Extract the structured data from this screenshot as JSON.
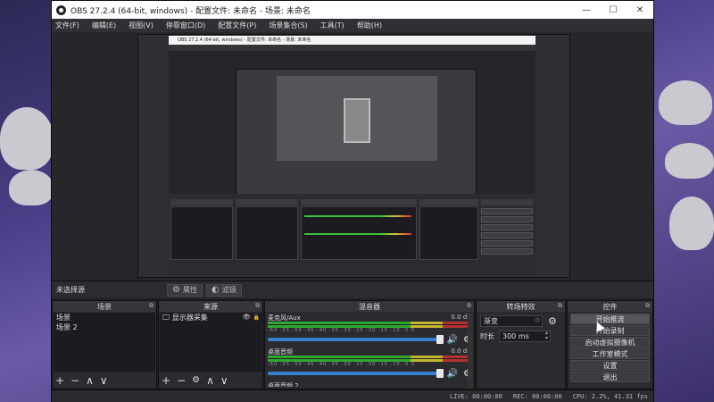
{
  "window": {
    "title": "OBS 27.2.4 (64-bit, windows) - 配置文件: 未命名 - 场景: 未命名",
    "controls": {
      "minimize": "—",
      "maximize": "☐",
      "close": "✕"
    }
  },
  "menu": [
    "文件(F)",
    "编辑(E)",
    "视图(V)",
    "停靠窗口(D)",
    "配置文件(P)",
    "场景集合(S)",
    "工具(T)",
    "帮助(H)"
  ],
  "preview": {
    "nested_title": "OBS 27.2.4 (64-bit, windows) - 配置文件: 未命名 - 场景: 未命名"
  },
  "scene_strip": {
    "label": "未选择源",
    "properties": "属性",
    "filters": "滤镜"
  },
  "docks": {
    "scenes": {
      "title": "场景",
      "items": [
        "场景",
        "场景 2"
      ]
    },
    "sources": {
      "title": "来源",
      "items": [
        "显示器采集"
      ]
    },
    "mixer": {
      "title": "混音器",
      "channels": [
        {
          "name": "麦克风/Aux",
          "value": "0.0 dB"
        },
        {
          "name": "桌面音频",
          "value": "0.0 dB"
        },
        {
          "name": "桌面音频 2",
          "value": ""
        }
      ],
      "ticks": "-60 -55 -50 -45 -40 -35 -30 -25 -20 -15 -10 -5 0"
    },
    "transitions": {
      "title": "转场特效",
      "selected": "渐变",
      "duration_label": "时长",
      "duration_value": "300 ms"
    },
    "controls": {
      "title": "控件",
      "buttons": [
        "开始推流",
        "开始录制",
        "启动虚拟摄像机",
        "工作室模式",
        "设置",
        "退出"
      ]
    }
  },
  "status": {
    "live": "LIVE: 00:00:00",
    "rec": "REC: 00:00:00",
    "cpu": "CPU: 2.2%, 41.31 fps"
  },
  "icons": {
    "gear": "⚙",
    "filter": "◐",
    "eye": "👁",
    "lock": "🔒",
    "monitor": "🖵",
    "speaker": "🔊",
    "add": "+",
    "remove": "−",
    "up": "∧",
    "down": "∨"
  }
}
